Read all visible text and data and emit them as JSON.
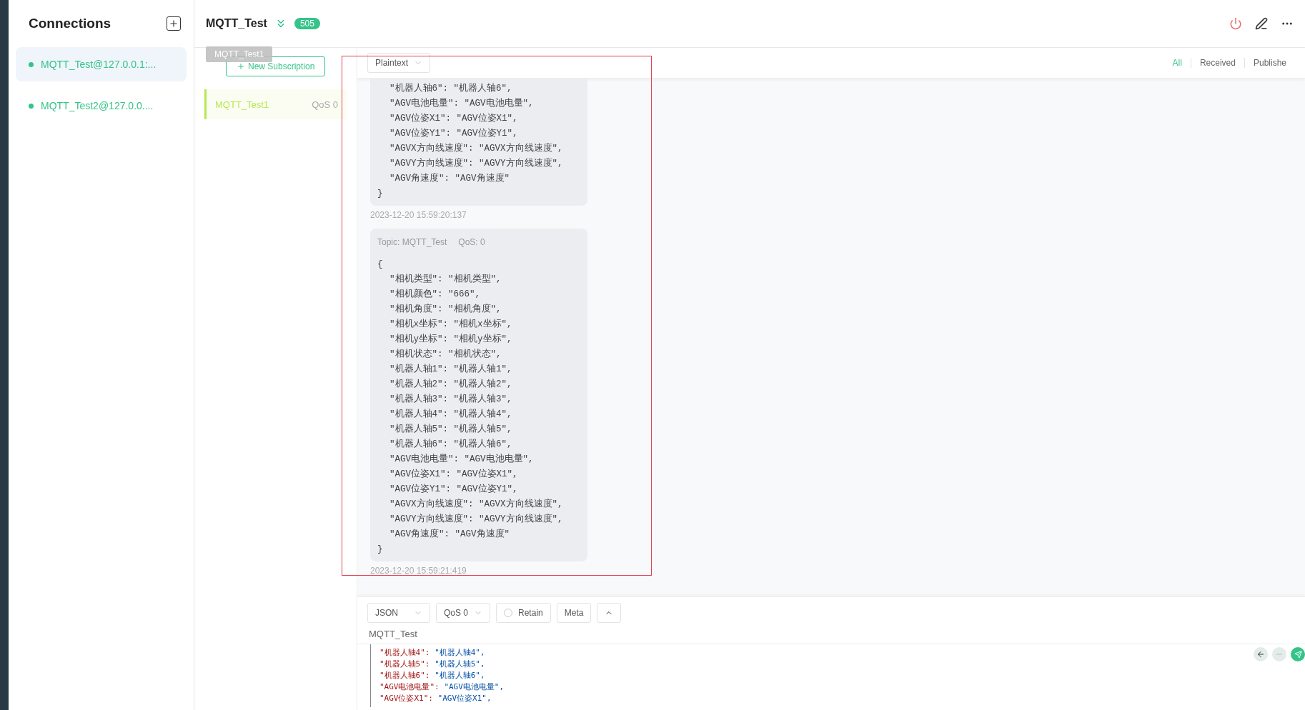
{
  "sidebar": {
    "title": "Connections",
    "connections": [
      {
        "name": "MQTT_Test@127.0.0.1:...",
        "selected": true
      },
      {
        "name": "MQTT_Test2@127.0.0....",
        "selected": false
      }
    ]
  },
  "header": {
    "title": "MQTT_Test",
    "badge": "505"
  },
  "subscriptions": {
    "new_button": "New Subscription",
    "tooltip": "MQTT_Test1",
    "items": [
      {
        "topic": "MQTT_Test1",
        "qos": "QoS 0",
        "color": "#b5e853"
      }
    ]
  },
  "message_toolbar": {
    "format": "Plaintext",
    "filters": [
      {
        "label": "All",
        "selected": true
      },
      {
        "label": "Received",
        "selected": false
      },
      {
        "label": "Publishe",
        "selected": false
      }
    ]
  },
  "messages": [
    {
      "lines": [
        "\"机器人轴6\": \"机器人轴6\",",
        "\"AGV电池电量\": \"AGV电池电量\",",
        "\"AGV位姿X1\": \"AGV位姿X1\",",
        "\"AGV位姿Y1\": \"AGV位姿Y1\",",
        "\"AGVX方向线速度\": \"AGVX方向线速度\",",
        "\"AGVY方向线速度\": \"AGVY方向线速度\",",
        "\"AGV角速度\": \"AGV角速度\""
      ],
      "close": "}",
      "time": "2023-12-20 15:59:20:137"
    },
    {
      "topic": "Topic: MQTT_Test",
      "qos": "QoS: 0",
      "open": "{",
      "lines": [
        "\"相机类型\": \"相机类型\",",
        "\"相机颜色\": \"666\",",
        "\"相机角度\": \"相机角度\",",
        "\"相机x坐标\": \"相机x坐标\",",
        "\"相机y坐标\": \"相机y坐标\",",
        "\"相机状态\": \"相机状态\",",
        "\"机器人轴1\": \"机器人轴1\",",
        "\"机器人轴2\": \"机器人轴2\",",
        "\"机器人轴3\": \"机器人轴3\",",
        "\"机器人轴4\": \"机器人轴4\",",
        "\"机器人轴5\": \"机器人轴5\",",
        "\"机器人轴6\": \"机器人轴6\",",
        "\"AGV电池电量\": \"AGV电池电量\",",
        "\"AGV位姿X1\": \"AGV位姿X1\",",
        "\"AGV位姿Y1\": \"AGV位姿Y1\",",
        "\"AGVX方向线速度\": \"AGVX方向线速度\",",
        "\"AGVY方向线速度\": \"AGVY方向线速度\",",
        "\"AGV角速度\": \"AGV角速度\""
      ],
      "close": "}",
      "time": "2023-12-20 15:59:21:419"
    }
  ],
  "publish": {
    "format": "JSON",
    "qos": "QoS 0",
    "retain": {
      "label": "Retain",
      "checked": false
    },
    "meta": "Meta",
    "topic": "MQTT_Test",
    "editor_lines": [
      {
        "key": "\"机器人轴4\":",
        "value": "\"机器人轴4\","
      },
      {
        "key": "\"机器人轴5\":",
        "value": "\"机器人轴5\","
      },
      {
        "key": "\"机器人轴6\":",
        "value": "\"机器人轴6\","
      },
      {
        "key": "\"AGV电池电量\":",
        "value": "\"AGV电池电量\","
      },
      {
        "key": "\"AGV位姿X1\":",
        "value": "\"AGV位姿X1\","
      }
    ]
  }
}
